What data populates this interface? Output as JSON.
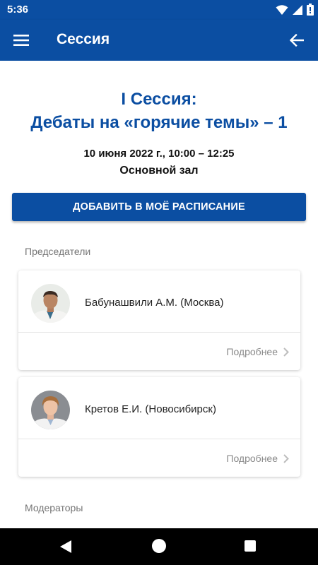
{
  "status_bar": {
    "time": "5:36",
    "icons": [
      "wifi-icon",
      "signal-icon",
      "battery-icon"
    ]
  },
  "app_bar": {
    "title": "Сессия",
    "menu_icon": "hamburger-menu-icon",
    "back_icon": "arrow-left-icon"
  },
  "session": {
    "title_line1": "I Сессия:",
    "title_line2": "Дебаты на «горячие темы» – 1",
    "date": "10 июня 2022 г., 10:00 – 12:25",
    "hall": "Основной зал",
    "add_button": "ДОБАВИТЬ В МОЁ РАСПИСАНИЕ"
  },
  "chairs": {
    "label": "Председатели",
    "items": [
      {
        "name": "Бабунашвили А.М. (Москва)",
        "more": "Подробнее"
      },
      {
        "name": "Кретов Е.И. (Новосибирск)",
        "more": "Подробнее"
      }
    ]
  },
  "moderators": {
    "label": "Модераторы"
  },
  "colors": {
    "primary": "#0b4ea2",
    "muted": "#757575",
    "white": "#ffffff"
  }
}
